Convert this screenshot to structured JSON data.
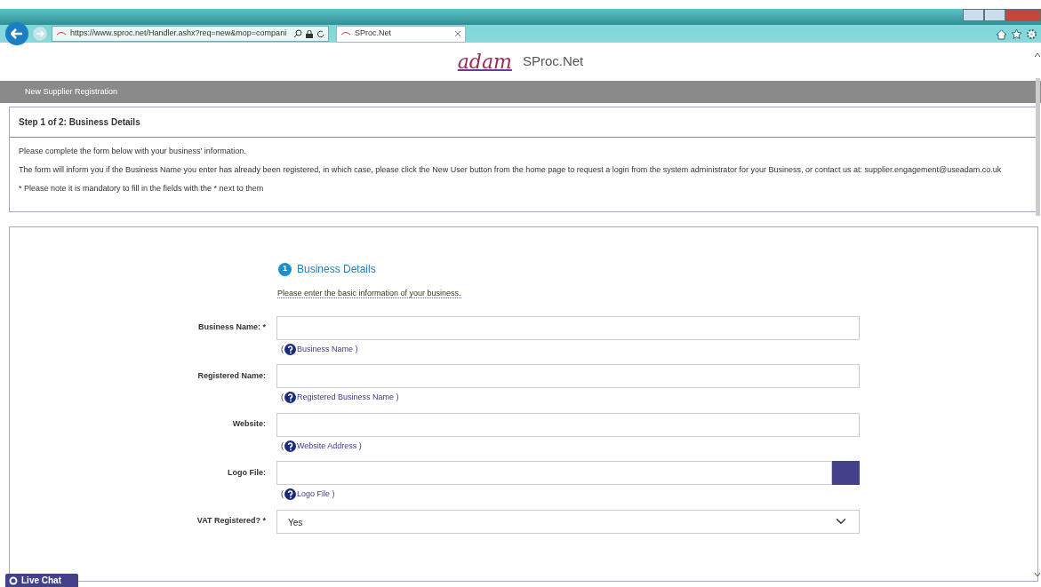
{
  "browser": {
    "url": "https://www.sproc.net/Handler.ashx?req=new&mop=compani",
    "tab_title": "SProc.Net"
  },
  "header": {
    "logo": "adam",
    "product": "SProc.Net"
  },
  "nav_bar": {
    "title": "New Supplier Registration"
  },
  "step_card": {
    "title": "Step 1 of 2: Business Details",
    "paragraphs": [
      "Please complete the form below with your business' information.",
      "The form will inform you if the Business Name you enter has already been registered, in which case, please click the New User button from the home page to request a login from the system administrator for your Business, or contact us at: supplier.engagement@useadam.co.uk",
      "* Please note it is mandatory to fill in the fields with the * next to them"
    ]
  },
  "form": {
    "step_number": "1",
    "section_title": "Business Details",
    "hint": "Please enter the basic information of your business.",
    "fields": [
      {
        "kind": "text",
        "label": "Business Name: *",
        "help_open": "(",
        "help": "Business Name )"
      },
      {
        "kind": "text",
        "label": "Registered Name:",
        "help_open": "(",
        "help": "Registered Business Name )"
      },
      {
        "kind": "text",
        "label": "Website:",
        "help_open": "(",
        "help": "Website Address )"
      },
      {
        "kind": "file",
        "label": "Logo File:",
        "help_open": "(",
        "help": "Logo File )"
      },
      {
        "kind": "select",
        "label": "VAT Registered? *",
        "value": "Yes"
      }
    ]
  },
  "live_chat": {
    "label": "Live Chat"
  }
}
